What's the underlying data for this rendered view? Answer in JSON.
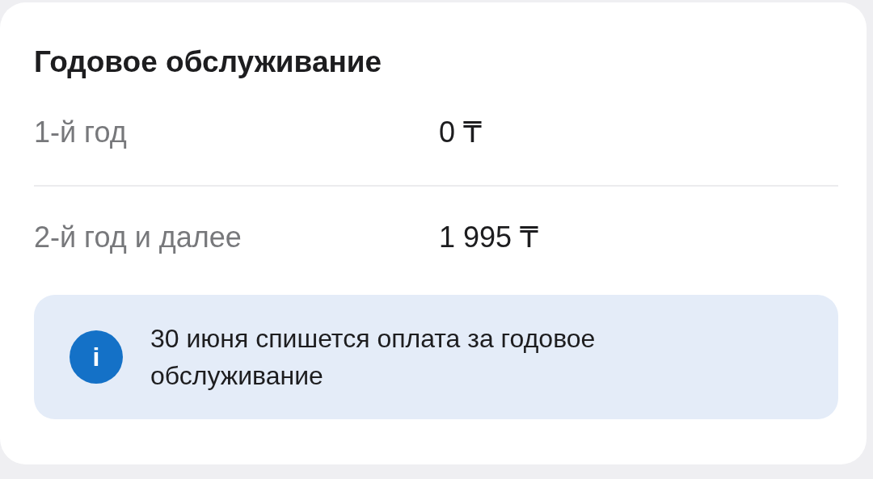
{
  "card": {
    "title": "Годовое обслуживание",
    "rows": [
      {
        "label": "1-й год",
        "value": "0 ₸"
      },
      {
        "label": "2-й год и далее",
        "value": "1 995 ₸"
      }
    ],
    "notice": {
      "icon_text": "i",
      "text": "30 июня спишется оплата за годовое обслуживание"
    }
  }
}
